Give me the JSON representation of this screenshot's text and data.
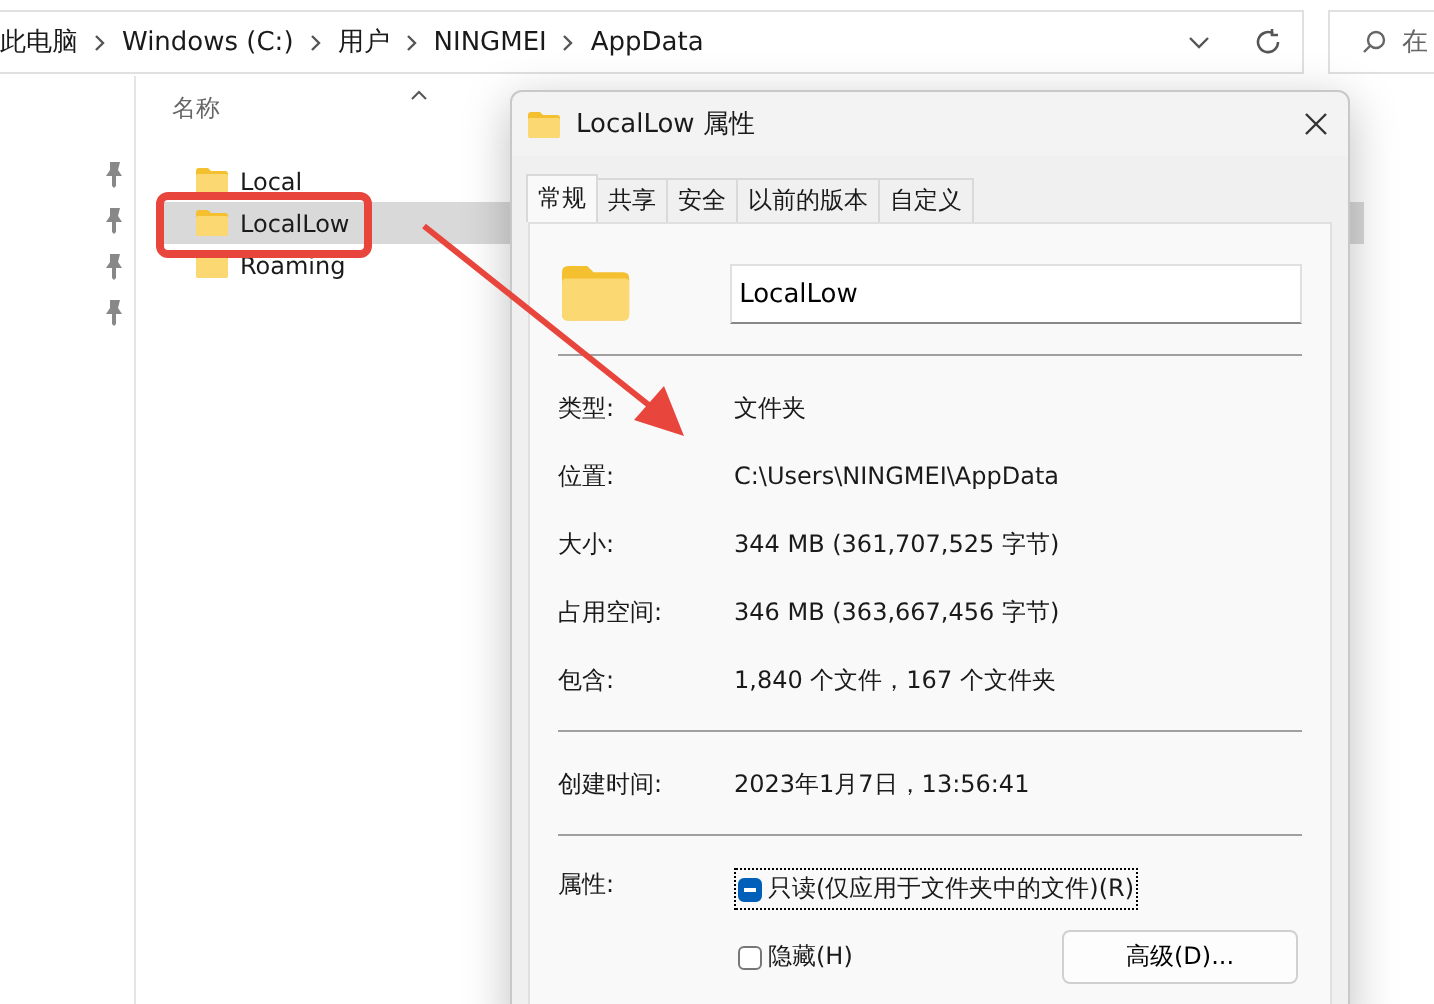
{
  "address_bar": {
    "crumbs": [
      "此电脑",
      "Windows (C:)",
      "用户",
      "NINGMEI",
      "AppData"
    ]
  },
  "search": {
    "placeholder": "在"
  },
  "nav_pane": {
    "items": [
      {
        "kind": "pin"
      },
      {
        "kind": "pin"
      },
      {
        "kind": "pin"
      },
      {
        "kind": "pin"
      }
    ]
  },
  "file_list": {
    "column": "名称",
    "items": [
      {
        "name": "Local",
        "selected": false
      },
      {
        "name": "LocalLow",
        "selected": true
      },
      {
        "name": "Roaming",
        "selected": false
      }
    ]
  },
  "dialog": {
    "title": "LocalLow 属性",
    "tabs": [
      {
        "label": "常规",
        "selected": true
      },
      {
        "label": "共享",
        "selected": false
      },
      {
        "label": "安全",
        "selected": false
      },
      {
        "label": "以前的版本",
        "selected": false
      },
      {
        "label": "自定义",
        "selected": false
      }
    ],
    "name_value": "LocalLow",
    "groups": [
      [
        {
          "label": "类型:",
          "value": "文件夹"
        },
        {
          "label": "位置:",
          "value": "C:\\Users\\NINGMEI\\AppData"
        },
        {
          "label": "大小:",
          "value": "344 MB (361,707,525 字节)"
        },
        {
          "label": "占用空间:",
          "value": "346 MB (363,667,456 字节)"
        },
        {
          "label": "包含:",
          "value": "1,840 个文件，167 个文件夹"
        }
      ],
      [
        {
          "label": "创建时间:",
          "value": "2023年1月7日，13:56:41"
        }
      ]
    ],
    "attributes_label": "属性:",
    "attributes": [
      {
        "label": "只读(仅应用于文件夹中的文件)(R)",
        "checked": false,
        "indeterminate": true,
        "focused": true
      },
      {
        "label": "隐藏(H)",
        "checked": false,
        "indeterminate": false,
        "focused": false
      }
    ],
    "advanced_button": "高级(D)..."
  },
  "annotations": {
    "highlight_frame": true,
    "arrow": true
  }
}
